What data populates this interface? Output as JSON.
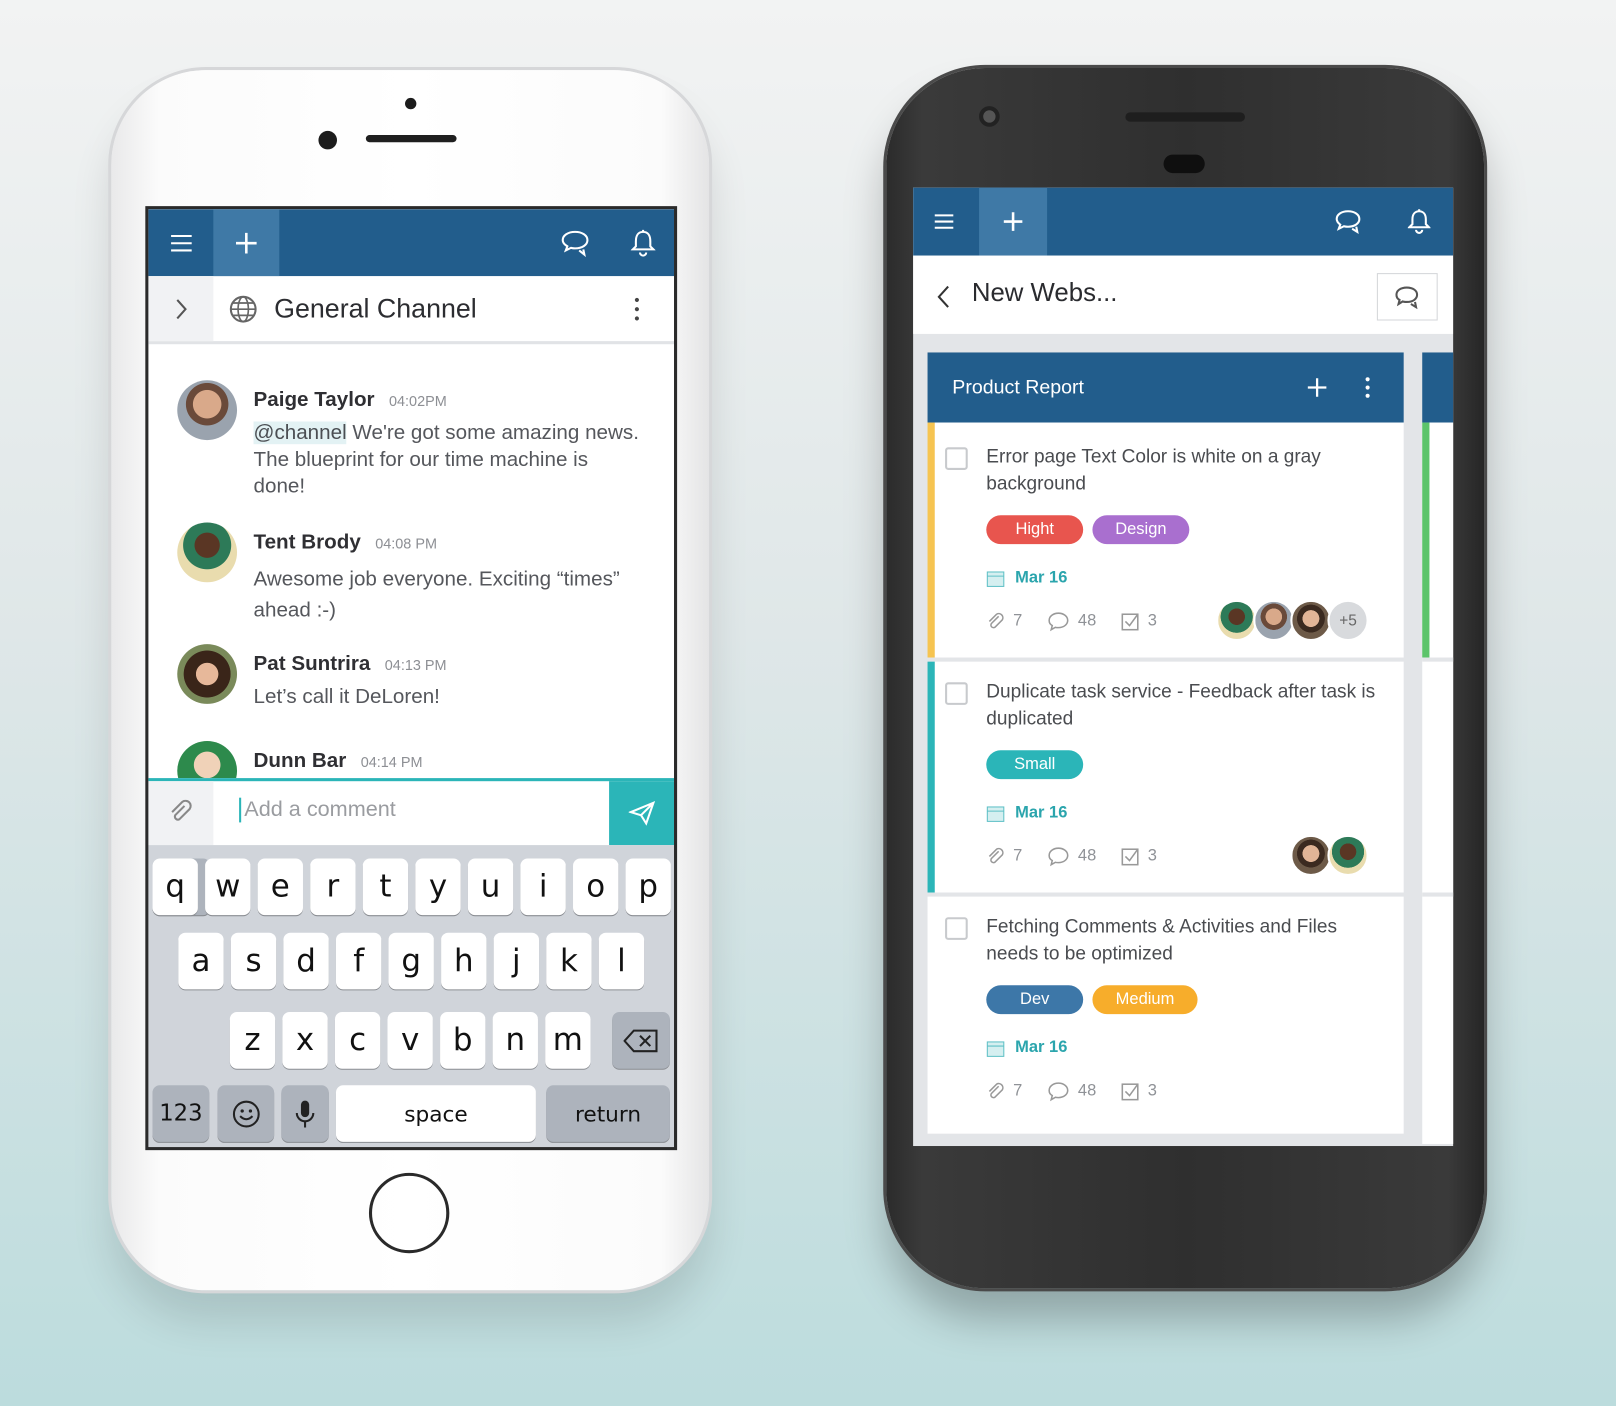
{
  "colors": {
    "brand": "#225d8c",
    "brand_light": "#3f79a6",
    "teal": "#2bb5b8",
    "date": "#2ba5ad"
  },
  "chat": {
    "channel_title": "General Channel",
    "messages": [
      {
        "name": "Paige Taylor",
        "time": "04:02PM",
        "mention": "@channel",
        "text": " We're got some amazing news. The blueprint for our time machine is done!"
      },
      {
        "name": "Tent Brody",
        "time": "04:08 PM",
        "text": "Awesome job everyone. Exciting “times” ahead :-)"
      },
      {
        "name": "Pat Suntrira",
        "time": "04:13 PM",
        "text": "Let’s call it DeLoren!"
      },
      {
        "name": "Dunn Bar",
        "time": "04:14 PM",
        "text": ""
      }
    ],
    "comment_placeholder": "Add a comment"
  },
  "keyboard": {
    "row1": [
      "q",
      "w",
      "e",
      "r",
      "t",
      "y",
      "u",
      "i",
      "o",
      "p"
    ],
    "row2": [
      "a",
      "s",
      "d",
      "f",
      "g",
      "h",
      "j",
      "k",
      "l"
    ],
    "row3": [
      "z",
      "x",
      "c",
      "v",
      "b",
      "n",
      "m"
    ],
    "numbers": "123",
    "space": "space",
    "return": "return"
  },
  "board": {
    "project_title": "New Webs...",
    "column_title": "Product Report",
    "cards": [
      {
        "title": "Error page Text Color is white on a gray background",
        "stripe": "#f6c451",
        "tags": [
          {
            "label": "Hight",
            "color": "#e8554e"
          },
          {
            "label": "Design",
            "color": "#a96fcf"
          }
        ],
        "date": "Mar 16",
        "attachments": "7",
        "comments": "48",
        "subtasks": "3",
        "extra_assignees": "+5"
      },
      {
        "title": "Duplicate task service - Feedback after task is duplicated",
        "stripe": "#2bb5b8",
        "tags": [
          {
            "label": "Small",
            "color": "#2bb5b8"
          }
        ],
        "date": "Mar 16",
        "attachments": "7",
        "comments": "48",
        "subtasks": "3"
      },
      {
        "title": "Fetching Comments & Activities and Files needs to be optimized",
        "stripe": "",
        "tags": [
          {
            "label": "Dev",
            "color": "#3d77a8"
          },
          {
            "label": "Medium",
            "color": "#f7ad2b"
          }
        ],
        "date": "Mar 16",
        "attachments": "7",
        "comments": "48",
        "subtasks": "3"
      }
    ],
    "next_column_stripe": "#5cc46a"
  }
}
